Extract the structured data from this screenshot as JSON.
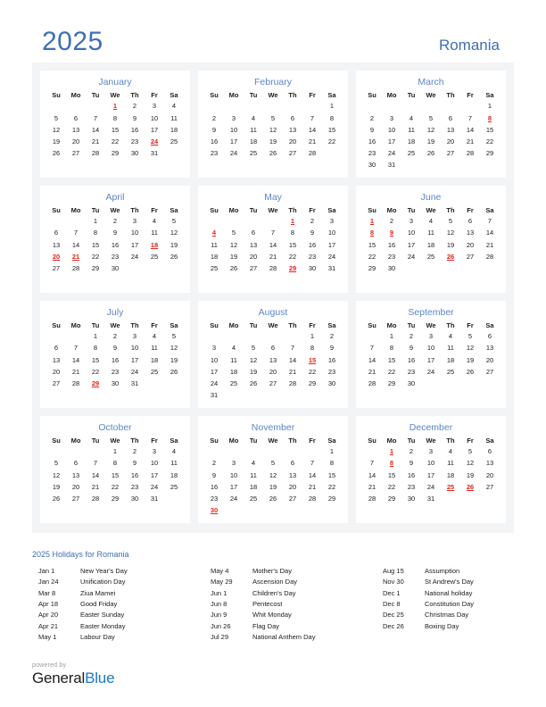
{
  "header": {
    "year": "2025",
    "country": "Romania"
  },
  "colors": {
    "accent_blue": "#3f6fb5",
    "month_title_blue": "#5a86c8",
    "holiday_red": "#e2231a",
    "panel_bg": "#f3f4f6",
    "brand_blue": "#1878c6"
  },
  "weekdays": [
    "Su",
    "Mo",
    "Tu",
    "We",
    "Th",
    "Fr",
    "Sa"
  ],
  "months": [
    {
      "name": "January",
      "lead_blanks": 3,
      "days": 31,
      "holidays": [
        1,
        24
      ]
    },
    {
      "name": "February",
      "lead_blanks": 6,
      "days": 28,
      "holidays": []
    },
    {
      "name": "March",
      "lead_blanks": 6,
      "days": 31,
      "holidays": [
        8
      ]
    },
    {
      "name": "April",
      "lead_blanks": 2,
      "days": 30,
      "holidays": [
        18,
        20,
        21
      ]
    },
    {
      "name": "May",
      "lead_blanks": 4,
      "days": 31,
      "holidays": [
        1,
        4,
        29
      ]
    },
    {
      "name": "June",
      "lead_blanks": 0,
      "days": 30,
      "holidays": [
        1,
        8,
        9,
        26
      ]
    },
    {
      "name": "July",
      "lead_blanks": 2,
      "days": 31,
      "holidays": [
        29
      ]
    },
    {
      "name": "August",
      "lead_blanks": 5,
      "days": 31,
      "holidays": [
        15
      ]
    },
    {
      "name": "September",
      "lead_blanks": 1,
      "days": 30,
      "holidays": []
    },
    {
      "name": "October",
      "lead_blanks": 3,
      "days": 31,
      "holidays": []
    },
    {
      "name": "November",
      "lead_blanks": 6,
      "days": 30,
      "holidays": [
        30
      ]
    },
    {
      "name": "December",
      "lead_blanks": 1,
      "days": 31,
      "holidays": [
        1,
        8,
        25,
        26
      ]
    }
  ],
  "holidays_section": {
    "title": "2025 Holidays for Romania",
    "columns": [
      [
        {
          "date": "Jan 1",
          "name": "New Year's Day"
        },
        {
          "date": "Jan 24",
          "name": "Unification Day"
        },
        {
          "date": "Mar 8",
          "name": "Ziua Mamei"
        },
        {
          "date": "Apr 18",
          "name": "Good Friday"
        },
        {
          "date": "Apr 20",
          "name": "Easter Sunday"
        },
        {
          "date": "Apr 21",
          "name": "Easter Monday"
        },
        {
          "date": "May 1",
          "name": "Labour Day"
        }
      ],
      [
        {
          "date": "May 4",
          "name": "Mother's Day"
        },
        {
          "date": "May 29",
          "name": "Ascension Day"
        },
        {
          "date": "Jun 1",
          "name": "Children's Day"
        },
        {
          "date": "Jun 8",
          "name": "Pentecost"
        },
        {
          "date": "Jun 9",
          "name": "Whit Monday"
        },
        {
          "date": "Jun 26",
          "name": "Flag Day"
        },
        {
          "date": "Jul 29",
          "name": "National Anthem Day"
        }
      ],
      [
        {
          "date": "Aug 15",
          "name": "Assumption"
        },
        {
          "date": "Nov 30",
          "name": "St Andrew's Day"
        },
        {
          "date": "Dec 1",
          "name": "National holiday"
        },
        {
          "date": "Dec 8",
          "name": "Constitution Day"
        },
        {
          "date": "Dec 25",
          "name": "Christmas Day"
        },
        {
          "date": "Dec 26",
          "name": "Boxing Day"
        }
      ]
    ]
  },
  "footer": {
    "powered_by": "powered by",
    "brand_part1": "General",
    "brand_part2": "Blue"
  }
}
